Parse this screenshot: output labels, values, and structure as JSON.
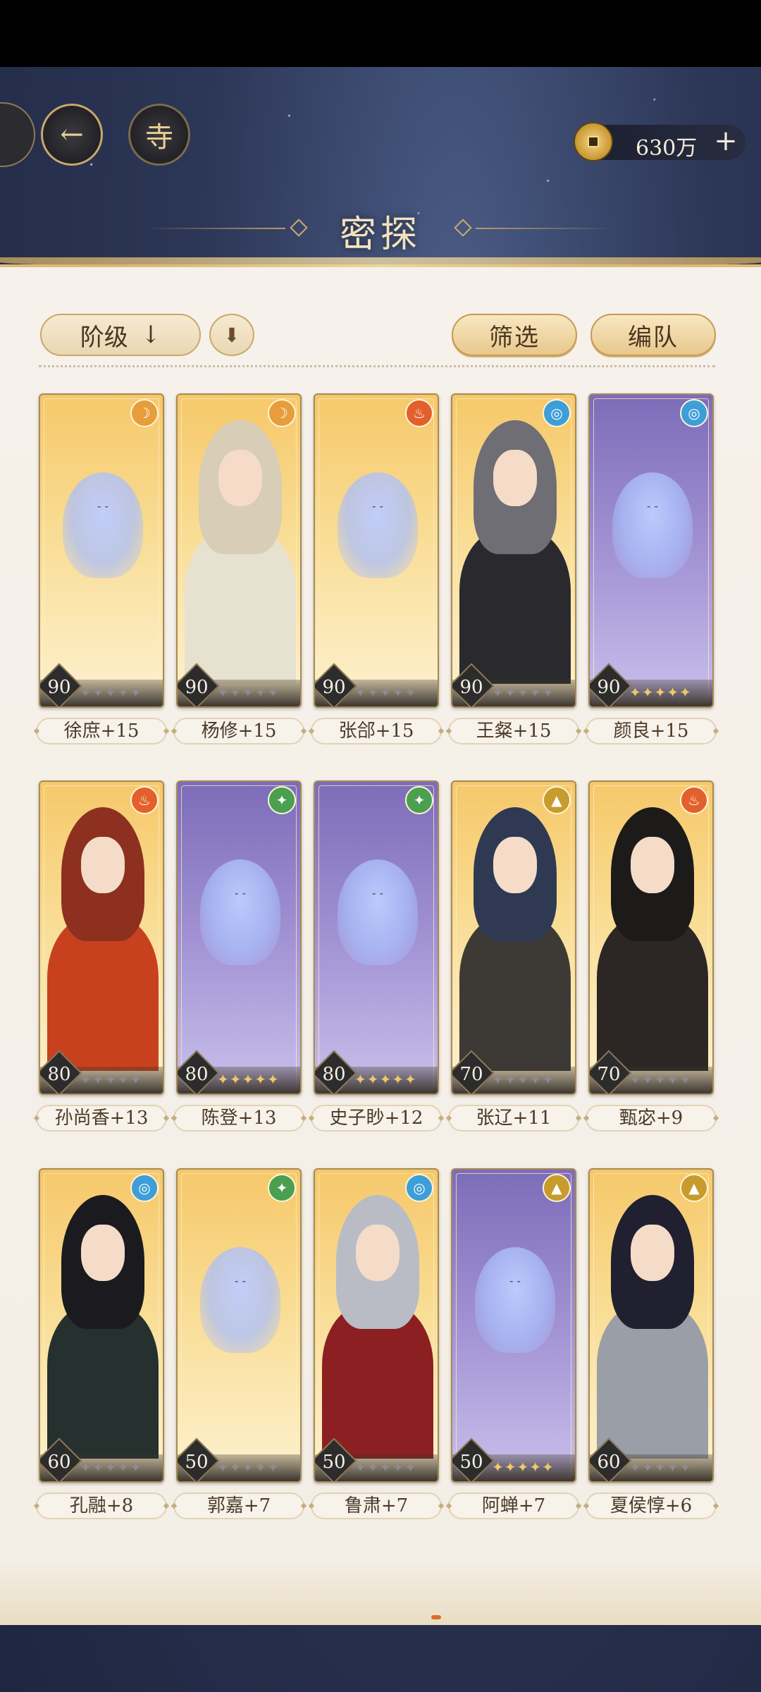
{
  "header": {
    "title": "密探",
    "currency_value": "630万",
    "add_label": "+"
  },
  "toolbar": {
    "sort_label": "阶级",
    "filter_label": "筛选",
    "team_label": "编队"
  },
  "colors": {
    "gold_card": "#f6c86a",
    "purple_card": "#7d6cb8",
    "panel_bg": "#f6f1ea",
    "accent_gold": "#c9a86a"
  },
  "characters": [
    {
      "name": "徐庶+15",
      "level": "90",
      "element": "moon",
      "rarity": "gold",
      "portrait": false,
      "stars": 5,
      "filled_stars": 0
    },
    {
      "name": "杨修+15",
      "level": "90",
      "element": "moon",
      "rarity": "gold",
      "portrait": true,
      "stars": 5,
      "filled_stars": 0
    },
    {
      "name": "张郃+15",
      "level": "90",
      "element": "fire",
      "rarity": "gold",
      "portrait": false,
      "stars": 5,
      "filled_stars": 0
    },
    {
      "name": "王粲+15",
      "level": "90",
      "element": "water",
      "rarity": "gold",
      "portrait": true,
      "stars": 5,
      "filled_stars": 0
    },
    {
      "name": "颜良+15",
      "level": "90",
      "element": "water",
      "rarity": "purple",
      "portrait": false,
      "stars": 5,
      "filled_stars": 5
    },
    {
      "name": "孙尚香+13",
      "level": "80",
      "element": "fire",
      "rarity": "gold",
      "portrait": true,
      "stars": 5,
      "filled_stars": 0
    },
    {
      "name": "陈登+13",
      "level": "80",
      "element": "wind",
      "rarity": "purple",
      "portrait": false,
      "stars": 5,
      "filled_stars": 5
    },
    {
      "name": "史子眇+12",
      "level": "80",
      "element": "wind",
      "rarity": "purple",
      "portrait": false,
      "stars": 5,
      "filled_stars": 5
    },
    {
      "name": "张辽+11",
      "level": "70",
      "element": "earth",
      "rarity": "gold",
      "portrait": true,
      "stars": 5,
      "filled_stars": 0
    },
    {
      "name": "甄宓+9",
      "level": "70",
      "element": "fire",
      "rarity": "gold",
      "portrait": true,
      "stars": 5,
      "filled_stars": 0
    },
    {
      "name": "孔融+8",
      "level": "60",
      "element": "water",
      "rarity": "gold",
      "portrait": true,
      "stars": 5,
      "filled_stars": 0
    },
    {
      "name": "郭嘉+7",
      "level": "50",
      "element": "wind",
      "rarity": "gold",
      "portrait": false,
      "stars": 5,
      "filled_stars": 0
    },
    {
      "name": "鲁肃+7",
      "level": "50",
      "element": "water",
      "rarity": "gold",
      "portrait": true,
      "stars": 5,
      "filled_stars": 0
    },
    {
      "name": "阿蝉+7",
      "level": "50",
      "element": "earth",
      "rarity": "purple",
      "portrait": false,
      "stars": 5,
      "filled_stars": 5
    },
    {
      "name": "夏侯惇+6",
      "level": "60",
      "element": "earth",
      "rarity": "gold",
      "portrait": true,
      "stars": 5,
      "filled_stars": 0
    }
  ]
}
